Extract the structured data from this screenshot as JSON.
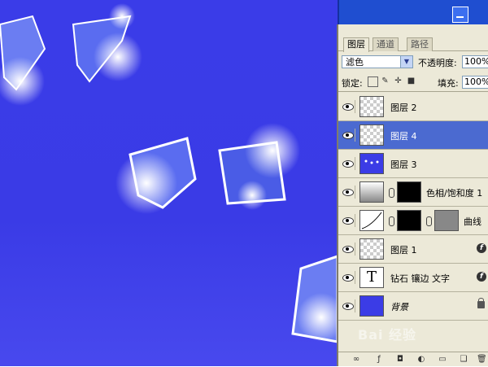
{
  "layers_panel": {
    "tabs": [
      "图层",
      "通道",
      "路径"
    ],
    "blend_mode": "滤色",
    "opacity_label": "不透明度:",
    "opacity_value": "100%",
    "lock_label": "锁定:",
    "fill_label": "填充:",
    "fill_value": "100%",
    "layers": [
      {
        "name": "图层 2",
        "thumb": "checker",
        "selected": false,
        "icon": ""
      },
      {
        "name": "图层 4",
        "thumb": "checker",
        "selected": true,
        "icon": ""
      },
      {
        "name": "图层 3",
        "thumb": "blue",
        "selected": false,
        "icon": ""
      },
      {
        "name": "色相/饱和度 1",
        "thumb": "adj",
        "selected": false,
        "icon": ""
      },
      {
        "name": "曲线",
        "thumb": "curve",
        "selected": false,
        "icon": ""
      },
      {
        "name": "图层 1",
        "thumb": "checker",
        "selected": false,
        "icon": "fx"
      },
      {
        "name": "钻石 镶边 文字",
        "thumb": "text",
        "thumb_letter": "T",
        "selected": false,
        "icon": "fx"
      },
      {
        "name": "背景",
        "thumb": "blue",
        "selected": false,
        "icon": "lock"
      }
    ]
  },
  "watermark": "Bai 经验",
  "colors": {
    "canvas": "#3a3ce8",
    "selected_layer": "#4b6ad0",
    "panel": "#ece9d8"
  }
}
